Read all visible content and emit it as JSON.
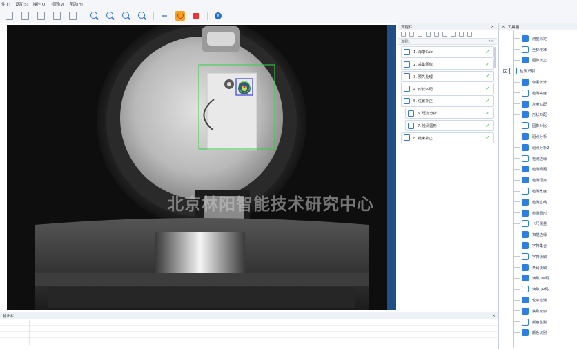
{
  "menu": [
    "件(F)",
    "设置(S)",
    "操作(O)",
    "视图(V)",
    "帮助(H)"
  ],
  "watermark": "北京林阳智能技术研究中心",
  "flow_panel": {
    "title": "流程栏",
    "tab": "流程1",
    "steps": [
      {
        "label": "1. 海康Cam",
        "sub": false
      },
      {
        "label": "2. 采集图像",
        "sub": false
      },
      {
        "label": "3. 预先处理",
        "sub": false
      },
      {
        "label": "4. 形状匹配",
        "sub": false
      },
      {
        "label": "5. 位置补正",
        "sub": false
      },
      {
        "label": "6. 斑点分析",
        "sub": true
      },
      {
        "label": "7. 检测圆形",
        "sub": true
      },
      {
        "label": "8. 结束补正",
        "sub": false
      }
    ]
  },
  "toolbox": {
    "title": "工具箱",
    "items_top": [
      "测量标定",
      "坐标校准",
      "图像校正"
    ],
    "group": "检测识别",
    "items": [
      "像素统计",
      "检测亮度",
      "灰度匹配",
      "形状匹配",
      "图像对比",
      "斑点分析",
      "斑点分析2",
      "检测边缘",
      "检测间距",
      "检测顶点",
      "检测宽度",
      "检测直线",
      "检测圆形",
      "卡尺测量",
      "扫描边缘",
      "字符集合",
      "字符读取",
      "条码读取",
      "读取DM码",
      "读取QR码",
      "轮廓检测",
      "获取轮廓",
      "颜色鉴别",
      "颜色识别"
    ]
  },
  "output_panel": {
    "title": "输出栏"
  }
}
